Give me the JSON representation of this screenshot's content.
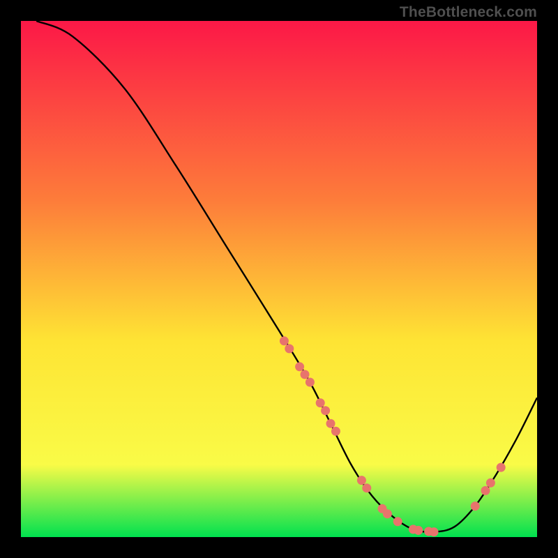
{
  "watermark": "TheBottleneck.com",
  "colors": {
    "gradient_top": "#fc1847",
    "gradient_upper_mid": "#fd7d3a",
    "gradient_mid": "#fee434",
    "gradient_lower_mid": "#f9fb47",
    "gradient_bottom": "#00e14f",
    "curve": "#000000",
    "dots": "#e8746c",
    "background": "#000000"
  },
  "chart_data": {
    "type": "line",
    "title": "",
    "xlabel": "",
    "ylabel": "",
    "xlim": [
      0,
      100
    ],
    "ylim": [
      0,
      100
    ],
    "curve": {
      "x": [
        3,
        10,
        20,
        30,
        40,
        50,
        56,
        60,
        64,
        68,
        72,
        76,
        80,
        84,
        88,
        92,
        96,
        100
      ],
      "y": [
        100,
        97,
        87,
        72,
        56,
        40,
        30,
        22,
        14,
        8,
        4,
        1.5,
        1,
        2,
        6,
        12,
        19,
        27
      ]
    },
    "series": [
      {
        "name": "dots-on-curve",
        "x": [
          51,
          52,
          54,
          55,
          56,
          58,
          59,
          60,
          61,
          66,
          67,
          70,
          71,
          73,
          76,
          77,
          79,
          80,
          88,
          90,
          91,
          93
        ],
        "y": [
          38,
          36.5,
          33,
          31.5,
          30,
          26,
          24.5,
          22,
          20.5,
          11,
          9.5,
          5.5,
          4.5,
          3,
          1.5,
          1.3,
          1.1,
          1,
          6,
          9,
          10.5,
          13.5
        ]
      }
    ]
  }
}
